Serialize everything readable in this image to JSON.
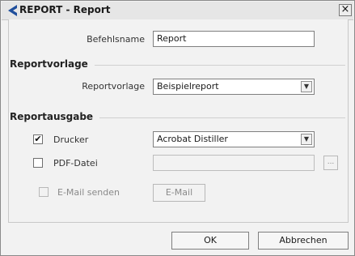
{
  "window": {
    "title": "REPORT - Report",
    "close_glyph": "×",
    "accent": "#1f4e9c"
  },
  "form": {
    "command_label": "Befehlsname",
    "command_value": "Report"
  },
  "template_section": {
    "title": "Reportvorlage",
    "label": "Reportvorlage",
    "selected": "Beispielreport"
  },
  "output_section": {
    "title": "Reportausgabe",
    "printer": {
      "label": "Drucker",
      "checked": true,
      "selected": "Acrobat Distiller"
    },
    "pdf": {
      "label": "PDF-Datei",
      "checked": false,
      "value": "",
      "browse_label": "..."
    },
    "email": {
      "label": "E-Mail senden",
      "checked": false,
      "button_label": "E-Mail"
    }
  },
  "footer": {
    "ok_label": "OK",
    "cancel_label": "Abbrechen"
  },
  "icons": {
    "combo_arrow": "▼",
    "check": "✔"
  }
}
